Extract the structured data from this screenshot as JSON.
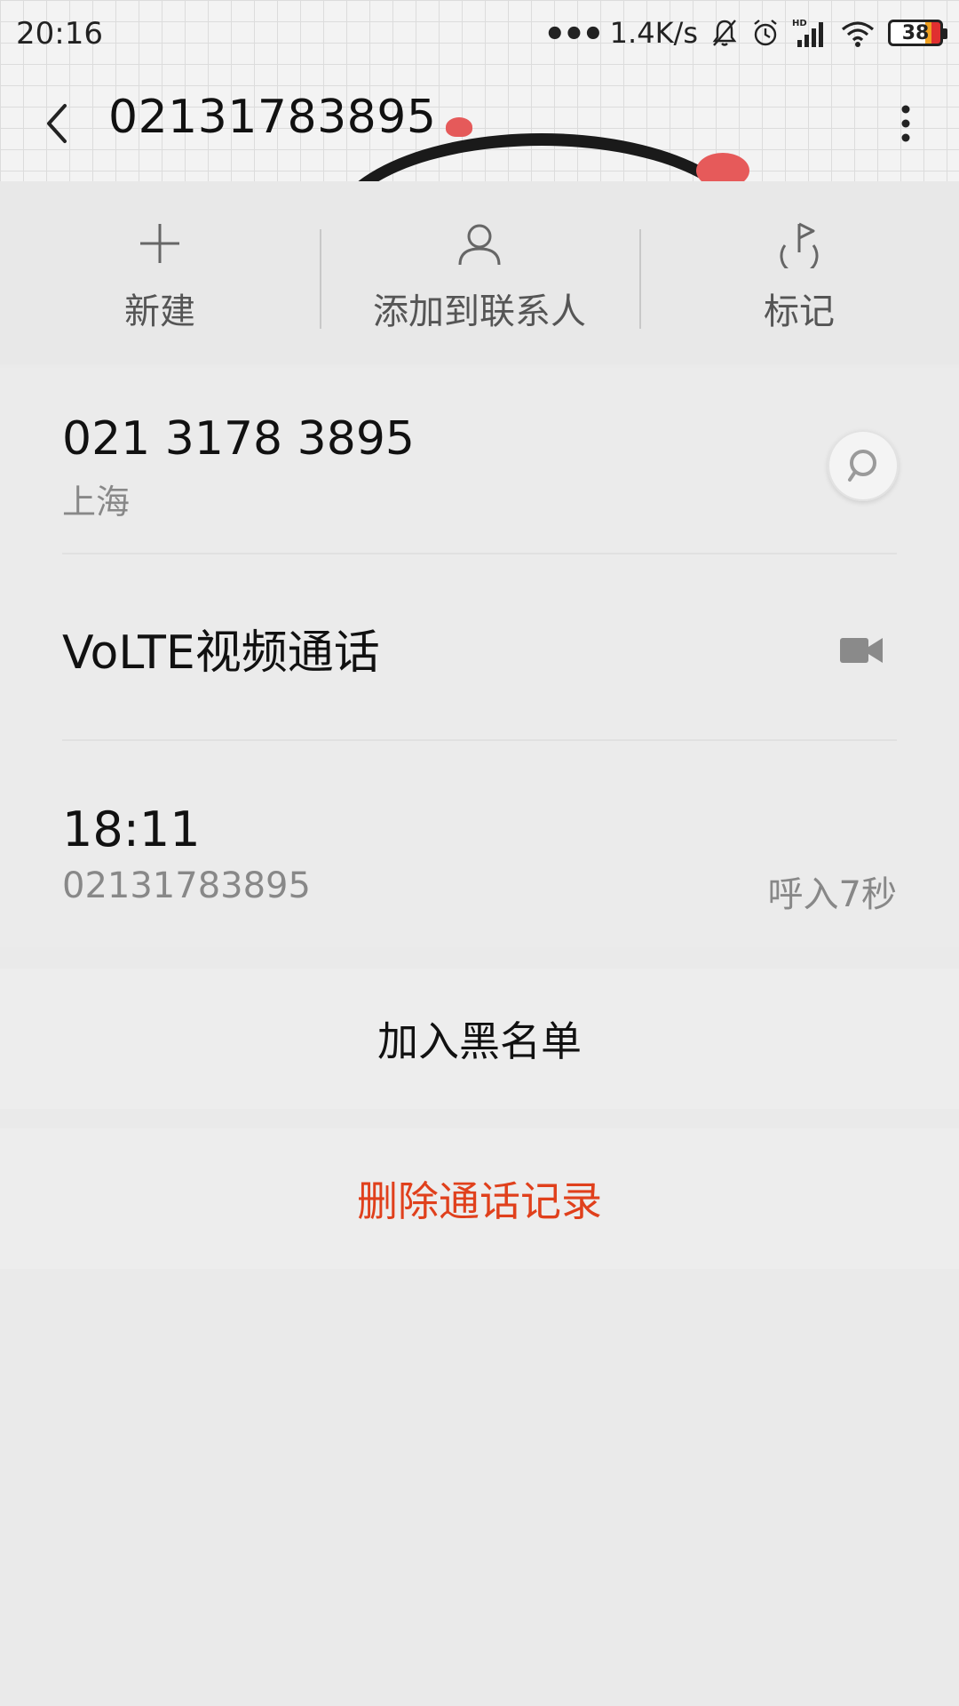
{
  "status_bar": {
    "time": "20:16",
    "more_dots": "•••",
    "speed": "1.4K/s",
    "battery_level": "38",
    "icons": [
      "mute-bell-icon",
      "alarm-icon",
      "signal-hd-icon",
      "wifi-icon",
      "battery-icon"
    ]
  },
  "toolbar": {
    "title": "02131783895",
    "back_icon": "chevron-left-icon",
    "more_icon": "more-vertical-icon"
  },
  "actions": [
    {
      "label": "新建",
      "icon": "plus-icon"
    },
    {
      "label": "添加到联系人",
      "icon": "person-icon"
    },
    {
      "label": "标记",
      "icon": "flag-icon"
    }
  ],
  "contact": {
    "number_formatted": "021 3178 3895",
    "location": "上海",
    "message_icon": "message-search-icon"
  },
  "volte": {
    "label": "VoLTE视频通话",
    "icon": "video-camera-icon"
  },
  "call_log": {
    "time": "18:11",
    "number": "02131783895",
    "detail": "呼入7秒"
  },
  "buttons": {
    "blacklist": "加入黑名单",
    "delete": "删除通话记录"
  },
  "colors": {
    "danger": "#e0401c",
    "background": "#eaeaea",
    "secondary_text": "#888888"
  }
}
